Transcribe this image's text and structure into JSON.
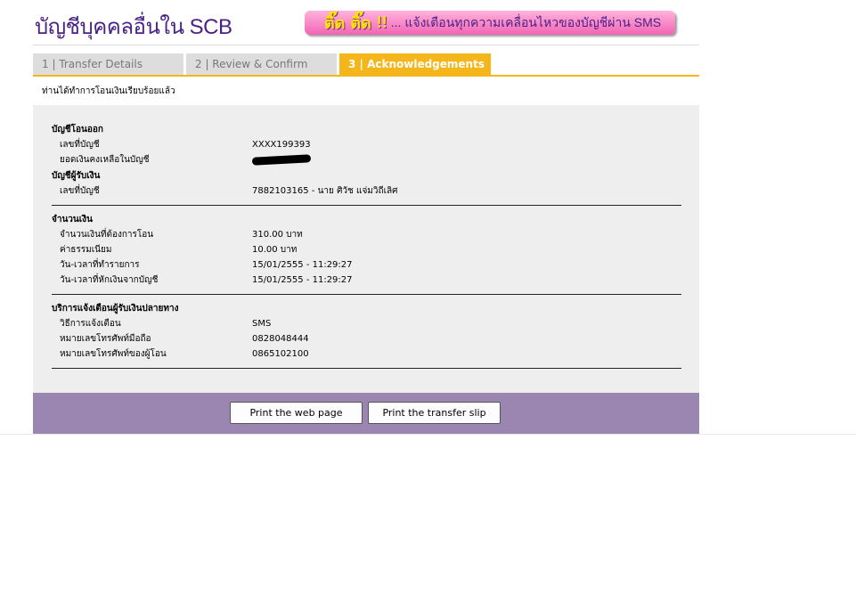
{
  "header": {
    "title": "บัญชีบุคคลอื่นใน SCB",
    "banner": {
      "hot1": "ติ๊ด",
      "hot2": "ติ๊ด",
      "bang": "!!",
      "text": "... แจ้งเตือนทุกความเคลื่อนไหวของบัญชีผ่าน SMS"
    }
  },
  "tabs": [
    {
      "label": "1 | Transfer Details",
      "active": false
    },
    {
      "label": "2 | Review & Confirm",
      "active": false
    },
    {
      "label": "3 | Acknowledgements",
      "active": true
    }
  ],
  "success_message": "ท่านได้ทำการโอนเงินเรียบร้อยแล้ว",
  "from_account": {
    "title": "บัญชีโอนออก",
    "rows": [
      {
        "label": "เลขที่บัญชี",
        "value": "XXXX199393"
      },
      {
        "label": "ยอดเงินคงเหลือในบัญชี",
        "value": ""
      }
    ]
  },
  "to_account": {
    "title": "บัญชีผู้รับเงิน",
    "rows": [
      {
        "label": "เลขที่บัญชี",
        "value": "7882103165 - นาย ศิวัช แจ่มวิถีเลิศ"
      }
    ]
  },
  "amount": {
    "title": "จำนวนเงิน",
    "rows": [
      {
        "label": "จำนวนเงินที่ต้องการโอน",
        "value": "310.00 บาท"
      },
      {
        "label": "ค่าธรรมเนียม",
        "value": "10.00 บาท"
      },
      {
        "label": "วัน-เวลาที่ทำรายการ",
        "value": "15/01/2555 - 11:29:27"
      },
      {
        "label": "วัน-เวลาที่หักเงินจากบัญชี",
        "value": "15/01/2555 - 11:29:27"
      }
    ]
  },
  "notification": {
    "title": "บริการแจ้งเตือนผู้รับเงินปลายทาง",
    "rows": [
      {
        "label": "วิธีการแจ้งเตือน",
        "value": "SMS"
      },
      {
        "label": "หมายเลขโทรศัพท์มือถือ",
        "value": "0828048444"
      },
      {
        "label": "หมายเลขโทรศัพท์ของผู้โอน",
        "value": "0865102100"
      }
    ]
  },
  "buttons": {
    "print_page": "Print the web page",
    "print_slip": "Print the transfer slip"
  },
  "colors": {
    "brand_purple": "#4b2285",
    "tab_active": "#f4b61a",
    "button_bar": "#9b86b2",
    "panel_bg": "#eeeeee"
  }
}
